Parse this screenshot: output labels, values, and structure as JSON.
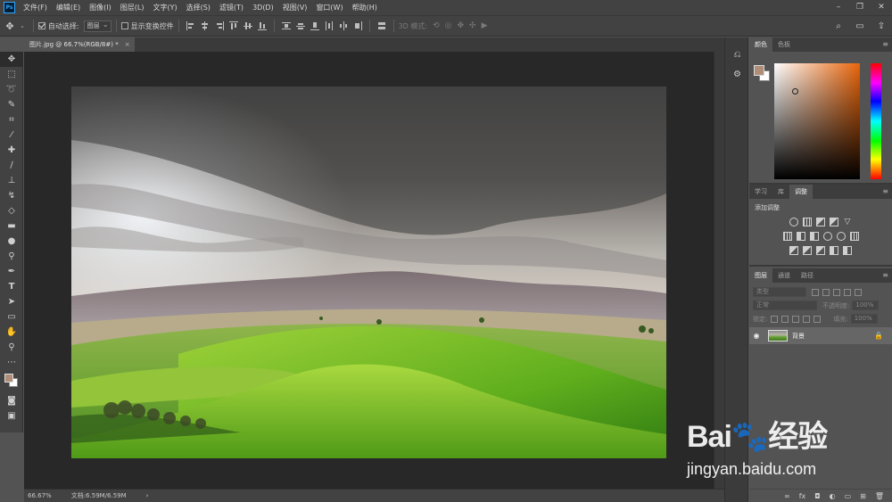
{
  "app": {
    "logo_text": "Ps"
  },
  "menu": [
    "文件(F)",
    "编辑(E)",
    "图像(I)",
    "图层(L)",
    "文字(Y)",
    "选择(S)",
    "滤镜(T)",
    "3D(D)",
    "视图(V)",
    "窗口(W)",
    "帮助(H)"
  ],
  "window_controls": [
    "–",
    "❐",
    "✕"
  ],
  "options": {
    "auto_select_label": "自动选择:",
    "auto_select_checked": true,
    "auto_select_target": "图层",
    "show_transform_label": "显示变换控件",
    "show_transform_checked": false,
    "mode_3d_label": "3D 模式:"
  },
  "document": {
    "tab_title": "图片.jpg @ 66.7%(RGB/8#) *",
    "close": "×",
    "zoom": "66.67%",
    "doc_info": "文档:6.59M/6.59M",
    "status_arrow": "›"
  },
  "panels": {
    "color_tabs": [
      "颜色",
      "色板"
    ],
    "adjust_tabs": [
      "学习",
      "库",
      "调整"
    ],
    "adjust_title": "添加调整",
    "layers_tabs": [
      "图层",
      "通道",
      "路径"
    ],
    "layers": {
      "filter_placeholder": "类型",
      "blend_mode": "正常",
      "opacity_label": "不透明度:",
      "opacity_value": "100%",
      "lock_label": "锁定:",
      "fill_label": "填充:",
      "fill_value": "100%",
      "items": [
        {
          "name": "背景",
          "visible": true,
          "locked": true
        }
      ]
    },
    "footer_icons": [
      "link-icon",
      "fx-icon",
      "mask-icon",
      "adjustment-icon",
      "folder-icon",
      "new-layer-icon",
      "trash-icon"
    ],
    "footer_glyphs": [
      "∞",
      "fx",
      "◘",
      "◐",
      "▭",
      "⊞",
      "🗑"
    ]
  },
  "colors": {
    "foreground": "#b08d76",
    "background": "#ffffff",
    "accent": "#31a8ff"
  },
  "watermark": {
    "logo": "Bai🐾经验",
    "url": "jingyan.baidu.com"
  }
}
